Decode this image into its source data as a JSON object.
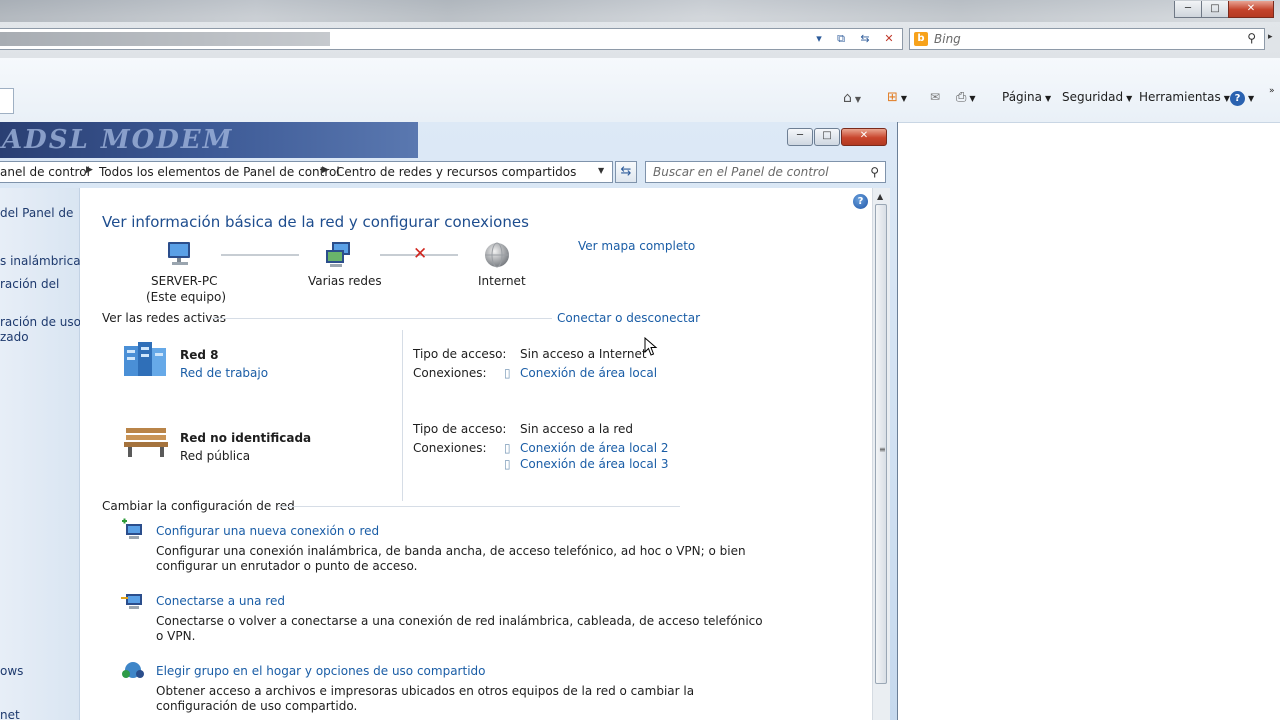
{
  "ie": {
    "search_placeholder": "Bing",
    "bing_logo": "b",
    "minimize": "─",
    "maximize": "□",
    "close": "✕",
    "commands": [
      "Página",
      "Seguridad",
      "Herramientas"
    ]
  },
  "window": {
    "title_art": "ADSL MODEM",
    "breadcrumb": [
      "anel de control",
      "Todos los elementos de Panel de control",
      "Centro de redes y recursos compartidos"
    ],
    "search_placeholder": "Buscar en el Panel de control",
    "minimize": "─",
    "maximize": "□",
    "close": "✕"
  },
  "left_pane": {
    "items": [
      "del Panel de",
      "s inalámbricas",
      "ración del",
      "ración de uso",
      "zado",
      "ows",
      "net"
    ]
  },
  "main": {
    "heading": "Ver información básica de la red y configurar conexiones",
    "view_full_map": "Ver mapa completo",
    "map": {
      "computer_name": "SERVER-PC",
      "computer_sub": "(Este equipo)",
      "middle_label": "Varias redes",
      "internet_label": "Internet"
    },
    "active_networks_label": "Ver las redes activas",
    "connect_disconnect": "Conectar o desconectar",
    "networks": [
      {
        "name": "Red  8",
        "type": "Red de trabajo",
        "access_label": "Tipo de acceso:",
        "access_value": "Sin acceso a Internet",
        "connections_label": "Conexiones:",
        "connections": [
          "Conexión de área local"
        ]
      },
      {
        "name": "Red no identificada",
        "type": "Red pública",
        "access_label": "Tipo de acceso:",
        "access_value": "Sin acceso a la red",
        "connections_label": "Conexiones:",
        "connections": [
          "Conexión de área local 2",
          "Conexión de área local 3"
        ]
      }
    ],
    "change_settings_label": "Cambiar la configuración de red",
    "tasks": [
      {
        "title": "Configurar una nueva conexión o red",
        "desc1": "Configurar una conexión inalámbrica, de banda ancha, de acceso telefónico, ad hoc o VPN; o bien",
        "desc2": "configurar un enrutador o punto de acceso."
      },
      {
        "title": "Conectarse a una red",
        "desc1": "Conectarse o volver a conectarse a una conexión de red inalámbrica, cableada, de acceso telefónico",
        "desc2": "o VPN."
      },
      {
        "title": "Elegir grupo en el hogar y opciones de uso compartido",
        "desc1": "Obtener acceso a archivos e impresoras ubicados en otros equipos de la red o cambiar la",
        "desc2": "configuración de uso compartido."
      }
    ]
  }
}
